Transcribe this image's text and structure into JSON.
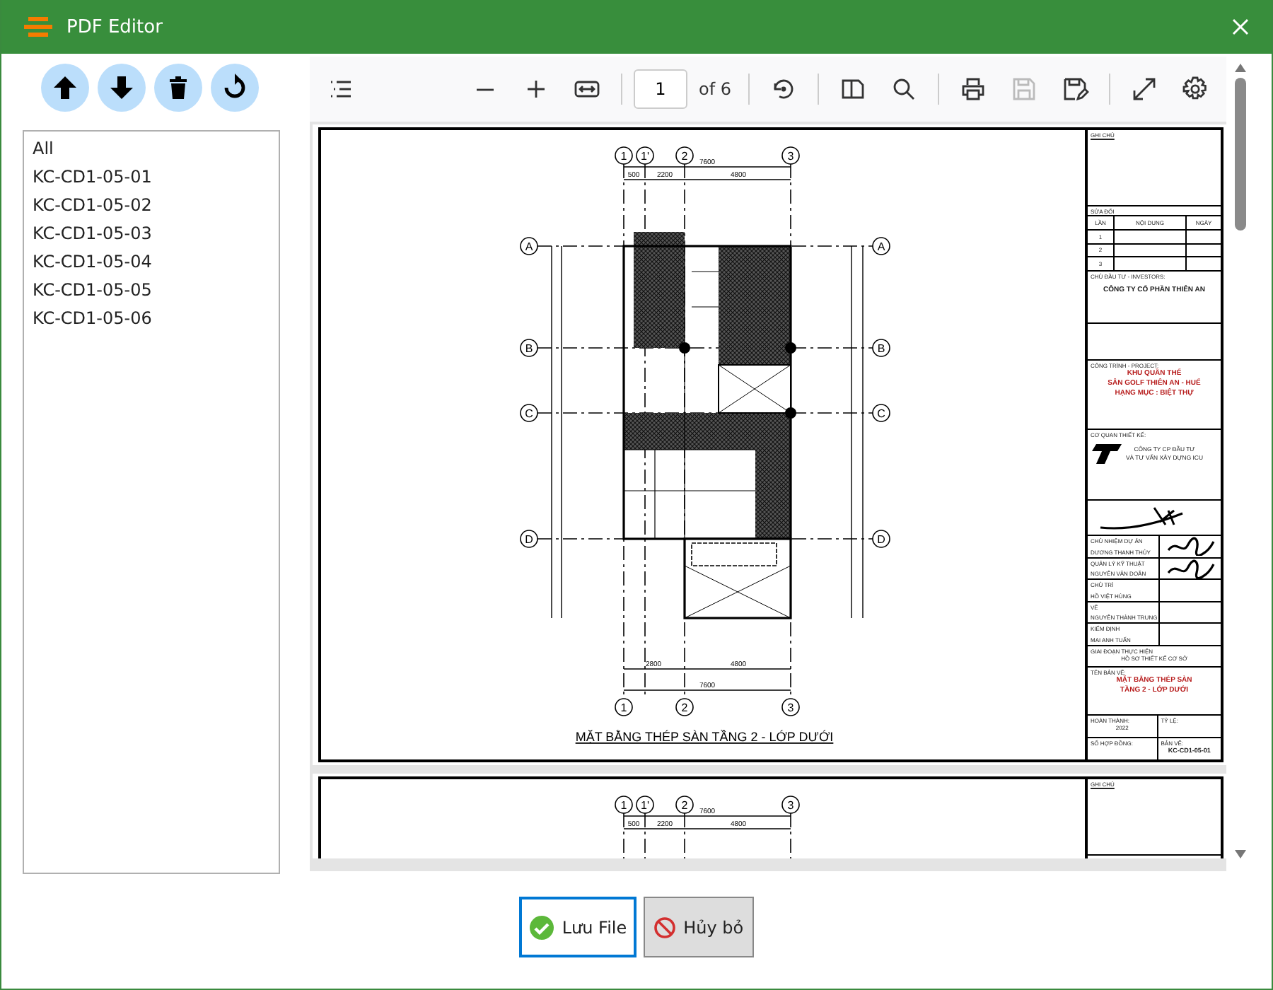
{
  "window": {
    "title": "PDF Editor"
  },
  "actions": [
    {
      "kind": "move-up"
    },
    {
      "kind": "move-down"
    },
    {
      "kind": "delete"
    },
    {
      "kind": "reset"
    }
  ],
  "file_list": {
    "items": [
      {
        "label": "All",
        "selected": false
      },
      {
        "label": "KC-CD1-05-01",
        "selected": false
      },
      {
        "label": "KC-CD1-05-02",
        "selected": false
      },
      {
        "label": "KC-CD1-05-03",
        "selected": false
      },
      {
        "label": "KC-CD1-05-04",
        "selected": false
      },
      {
        "label": "KC-CD1-05-05",
        "selected": false
      },
      {
        "label": "KC-CD1-05-06",
        "selected": false
      }
    ]
  },
  "viewer": {
    "toolbar": {
      "menu_tool": {
        "kind": "outline",
        "disabled": false
      },
      "groups": [
        [
          {
            "kind": "zoom-out",
            "disabled": false
          },
          {
            "kind": "zoom-in",
            "disabled": false
          },
          {
            "kind": "fit-width",
            "disabled": false
          }
        ],
        [
          {
            "kind": "rotate",
            "disabled": false
          }
        ],
        [
          {
            "kind": "two-page",
            "disabled": false
          },
          {
            "kind": "search",
            "disabled": false
          }
        ],
        [
          {
            "kind": "print",
            "disabled": false
          },
          {
            "kind": "save",
            "disabled": true
          },
          {
            "kind": "save-edit",
            "disabled": false
          }
        ],
        [
          {
            "kind": "fullscreen",
            "disabled": false
          },
          {
            "kind": "settings",
            "disabled": false
          }
        ]
      ],
      "page_field": {
        "value": "1"
      },
      "page_count": "of 6"
    },
    "pages": [
      {
        "plan": {
          "column_labels": [
            "1",
            "1'",
            "2",
            "3"
          ],
          "row_labels": [
            "A",
            "B",
            "C",
            "D"
          ],
          "right_row_labels": [
            "A",
            "B",
            "C",
            "D"
          ],
          "bottom_column_labels": [
            "1",
            "2",
            "3"
          ],
          "top_dimensions": {
            "overall": "7600",
            "spans": [
              "500",
              "2200",
              "4800"
            ]
          },
          "bottom_dimensions": {
            "spans": [
              "2800",
              "4800"
            ],
            "overall": "7600"
          },
          "title": "MẶT BẰNG THÉP SÀN TẦNG 2 - LỚP DƯỚI"
        },
        "title_block": {
          "notes_heading": "GHI CHÚ",
          "revisions": {
            "heading": "SỬA ĐỔI",
            "columns": [
              "LẦN",
              "NỘI DUNG",
              "NGÀY"
            ],
            "rows": [
              "1",
              "2",
              "3"
            ]
          },
          "investor": {
            "heading": "CHỦ ĐẦU TƯ - INVESTORS:",
            "name": "CÔNG TY CỔ PHẦN THIÊN AN"
          },
          "project": {
            "heading": "CÔNG TRÌNH - PROJECT:",
            "lines": [
              "KHU QUẦN THỂ",
              "SÂN GOLF THIÊN AN - HUẾ",
              "HẠNG MỤC : BIỆT THỰ"
            ]
          },
          "designer": {
            "heading": "CƠ QUAN THIẾT KẾ:",
            "lines": [
              "CÔNG TY CP ĐẦU TƯ",
              "VÀ TƯ VẤN XÂY DỰNG ICU"
            ]
          },
          "staff": [
            {
              "role": "CHỦ NHIỆM DỰ ÁN",
              "name": "DƯƠNG THANH THỦY",
              "signed": true
            },
            {
              "role": "QUẢN LÝ KỸ THUẬT",
              "name": "NGUYỄN VĂN DOÃN",
              "signed": true
            },
            {
              "role": "CHỦ TRÌ",
              "name": "HỒ VIỆT HÙNG",
              "signed": false
            },
            {
              "role": "VẼ",
              "name": "NGUYỄN THÀNH TRUNG",
              "signed": false
            },
            {
              "role": "KIỂM ĐỊNH",
              "name": "MAI ANH TUẤN",
              "signed": false
            }
          ],
          "phase": {
            "heading": "GIAI ĐOẠN THỰC HIỆN",
            "value": "HỒ SƠ THIẾT KẾ CƠ SỞ"
          },
          "drawing_name": {
            "heading": "TÊN BẢN VẼ:",
            "lines": [
              "MẶT BẰNG THÉP SÀN",
              "TẦNG 2 - LỚP DƯỚI"
            ]
          },
          "completed": {
            "label": "HOÀN THÀNH:",
            "value": "2022"
          },
          "scale": {
            "label": "TỶ LỆ:"
          },
          "contract": {
            "label": "SỐ HỢP ĐỒNG:"
          },
          "sheet": {
            "label": "BẢN VẼ:",
            "value": "KC-CD1-05-01"
          }
        }
      },
      {
        "plan": {
          "column_labels": [
            "1",
            "1'",
            "2",
            "3"
          ],
          "top_dimensions": {
            "overall": "7600",
            "spans": [
              "500",
              "2200",
              "4800"
            ]
          }
        },
        "title_block": {
          "notes_heading": "GHI CHÚ"
        }
      }
    ]
  },
  "footer_buttons": [
    {
      "label": "Lưu File",
      "kind": "save",
      "focused": true
    },
    {
      "label": "Hủy bỏ",
      "kind": "cancel",
      "focused": false
    }
  ]
}
